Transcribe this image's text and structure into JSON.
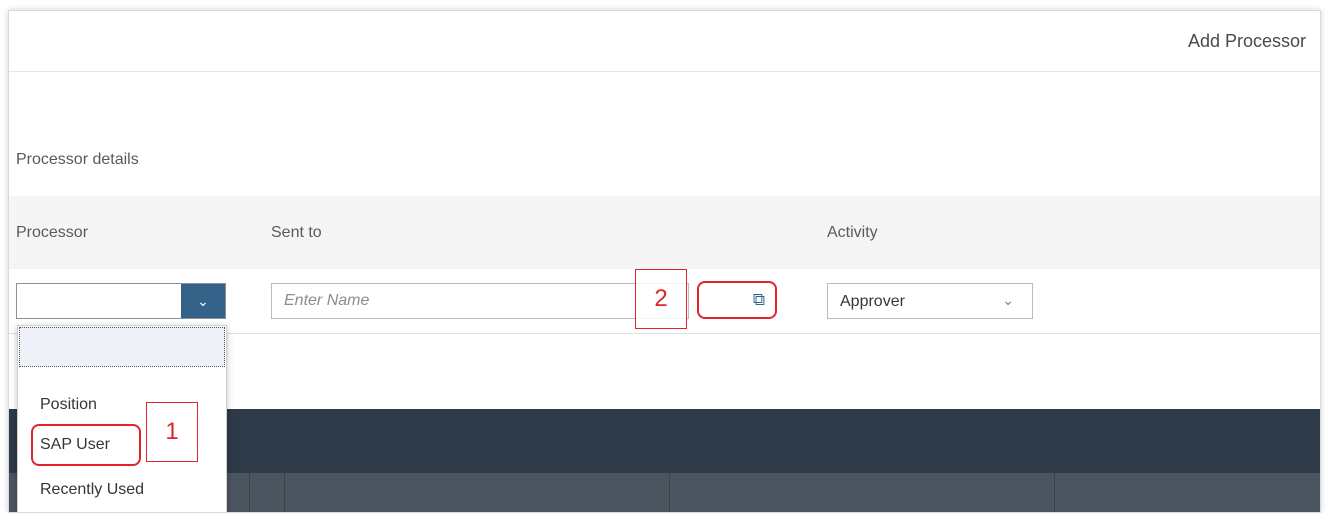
{
  "dialog": {
    "title": "Add Processor"
  },
  "section": {
    "title": "Processor details"
  },
  "columns": {
    "processor": "Processor",
    "sent_to": "Sent to",
    "activity": "Activity"
  },
  "form": {
    "processor_value": "",
    "sent_to_placeholder": "Enter Name",
    "activity_value": "Approver"
  },
  "dropdown": {
    "options": [
      "",
      "Position",
      "SAP User",
      "Recently Used"
    ]
  },
  "callouts": {
    "first": "1",
    "second": "2"
  },
  "icons": {
    "processor_arrow": "chevron-down-icon",
    "value_help": "value-help-icon",
    "activity_arrow": "chevron-down-icon"
  },
  "colors": {
    "accent": "#346187",
    "callout": "#e0242c",
    "band": "#2e3a47"
  }
}
